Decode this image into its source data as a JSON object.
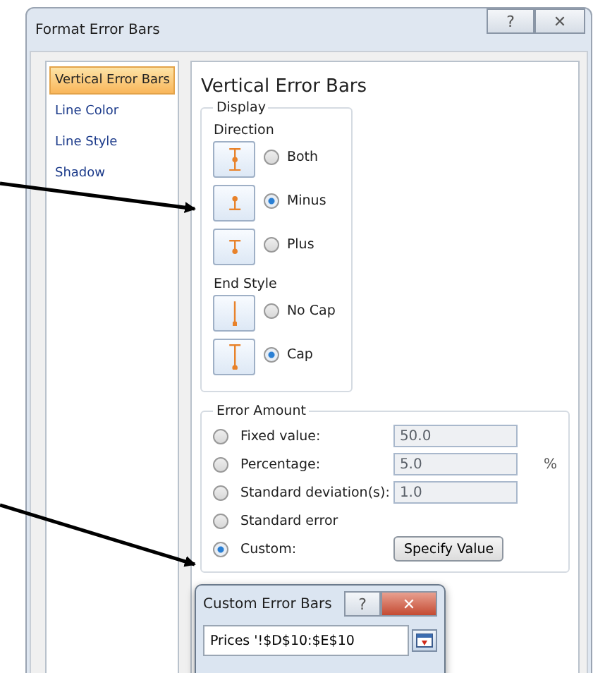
{
  "window": {
    "title": "Format Error Bars",
    "help_glyph": "?",
    "close_glyph": "✕"
  },
  "sidebar": {
    "items": [
      {
        "label": "Vertical Error Bars",
        "selected": true
      },
      {
        "label": "Line Color",
        "selected": false
      },
      {
        "label": "Line Style",
        "selected": false
      },
      {
        "label": "Shadow",
        "selected": false
      }
    ]
  },
  "panel": {
    "heading": "Vertical Error Bars",
    "display": {
      "legend": "Display",
      "direction_label": "Direction",
      "direction": [
        {
          "kind": "both",
          "label": "Both",
          "selected": false
        },
        {
          "kind": "minus",
          "label": "Minus",
          "selected": true
        },
        {
          "kind": "plus",
          "label": "Plus",
          "selected": false
        }
      ],
      "end_style_label": "End Style",
      "end_style": [
        {
          "kind": "nocap",
          "label": "No Cap",
          "selected": false
        },
        {
          "kind": "cap",
          "label": "Cap",
          "selected": true
        }
      ]
    },
    "error_amount": {
      "legend": "Error Amount",
      "options": [
        {
          "kind": "field",
          "label": "Fixed value:",
          "value": "50.0",
          "disabled": true,
          "selected": false
        },
        {
          "kind": "field",
          "label": "Percentage:",
          "value": "5.0",
          "unit": "%",
          "disabled": true,
          "selected": false
        },
        {
          "kind": "field",
          "label": "Standard deviation(s):",
          "value": "1.0",
          "disabled": true,
          "selected": false
        },
        {
          "kind": "plain",
          "label": "Standard error",
          "selected": false
        },
        {
          "kind": "button",
          "label": "Custom:",
          "button": "Specify Value",
          "selected": true
        }
      ]
    }
  },
  "popup": {
    "title": "Custom Error Bars",
    "help_glyph": "?",
    "close_glyph": "✕",
    "value": "Prices '!$D$10:$E$10"
  }
}
